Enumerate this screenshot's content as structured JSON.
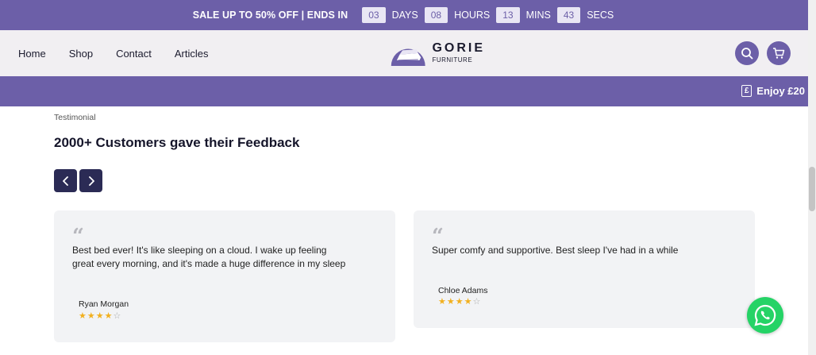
{
  "sale_bar": {
    "text": "SALE UP TO 50% OFF | ENDS IN",
    "countdown": [
      {
        "value": "03",
        "label": "DAYS"
      },
      {
        "value": "08",
        "label": "HOURS"
      },
      {
        "value": "13",
        "label": "MINS"
      },
      {
        "value": "43",
        "label": "SECS"
      }
    ]
  },
  "header": {
    "nav": [
      "Home",
      "Shop",
      "Contact",
      "Articles"
    ],
    "logo": {
      "name": "GORIE",
      "sub": "FURNITURE"
    },
    "icons": [
      "search-icon",
      "cart-icon"
    ]
  },
  "promo": {
    "text": "Enjoy £20",
    "icon": "pound-icon"
  },
  "testimonial": {
    "tag": "Testimonial",
    "title": "2000+ Customers gave their Feedback",
    "reviews": [
      {
        "text": "Best bed ever! It's like sleeping on a cloud. I wake up feeling great every morning, and it's made a huge difference in my sleep",
        "name": "Ryan Morgan",
        "rating": 4
      },
      {
        "text": "Super comfy and supportive. Best sleep I've had in a while",
        "name": "Chloe Adams",
        "rating": 4
      }
    ]
  },
  "colors": {
    "brand": "#6c5fa8",
    "header_bg": "#f1eff2",
    "card_bg": "#f2f3f5",
    "arrow_bg": "#2b2b55",
    "star": "#f2b01e",
    "whatsapp": "#25d366"
  }
}
